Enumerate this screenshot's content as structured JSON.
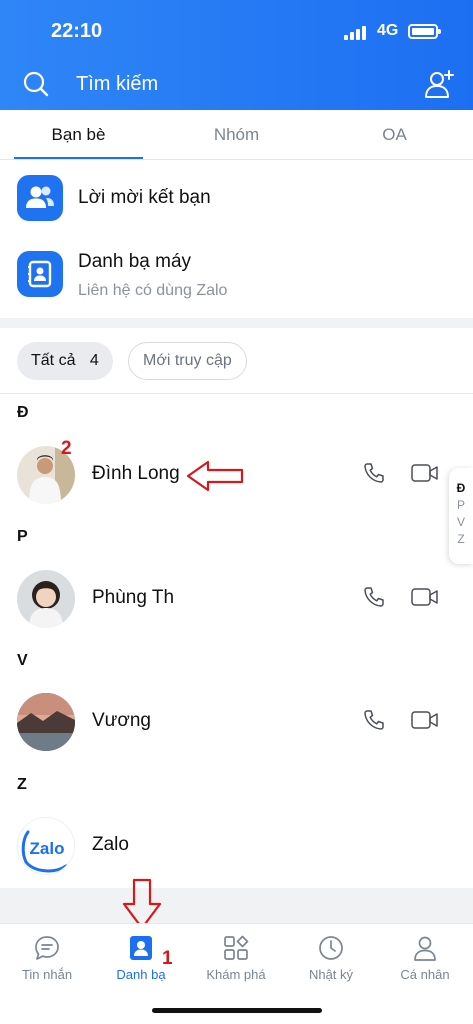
{
  "status_bar": {
    "time": "22:10",
    "network": "4G"
  },
  "header": {
    "search_placeholder": "Tìm kiếm"
  },
  "tabs": [
    {
      "label": "Bạn bè",
      "active": true
    },
    {
      "label": "Nhóm",
      "active": false
    },
    {
      "label": "OA",
      "active": false
    }
  ],
  "menu": {
    "friend_requests": {
      "title": "Lời mời kết bạn"
    },
    "phonebook": {
      "title": "Danh bạ máy",
      "subtitle": "Liên hệ có dùng Zalo"
    }
  },
  "filters": {
    "all_label": "Tất cả",
    "all_count": "4",
    "recent_label": "Mới truy cập"
  },
  "sections": [
    {
      "letter": "Đ",
      "contacts": [
        {
          "name": "Đình Long"
        }
      ]
    },
    {
      "letter": "P",
      "contacts": [
        {
          "name": "Phùng Th"
        }
      ]
    },
    {
      "letter": "V",
      "contacts": [
        {
          "name": "Vương"
        }
      ]
    },
    {
      "letter": "Z",
      "contacts": [
        {
          "name": "Zalo",
          "avatar_text": "Zalo"
        }
      ]
    }
  ],
  "alpha_index": [
    "Đ",
    "P",
    "V",
    "Z"
  ],
  "annotations": {
    "step_1": "1",
    "step_2": "2"
  },
  "bottom_nav": [
    {
      "label": "Tin nhắn",
      "icon": "chat-icon"
    },
    {
      "label": "Danh bạ",
      "icon": "contacts-icon",
      "active": true
    },
    {
      "label": "Khám phá",
      "icon": "discover-icon"
    },
    {
      "label": "Nhật ký",
      "icon": "clock-icon"
    },
    {
      "label": "Cá nhân",
      "icon": "person-icon"
    }
  ],
  "colors": {
    "primary": "#1d6ff2",
    "annotation": "#d7191c"
  }
}
